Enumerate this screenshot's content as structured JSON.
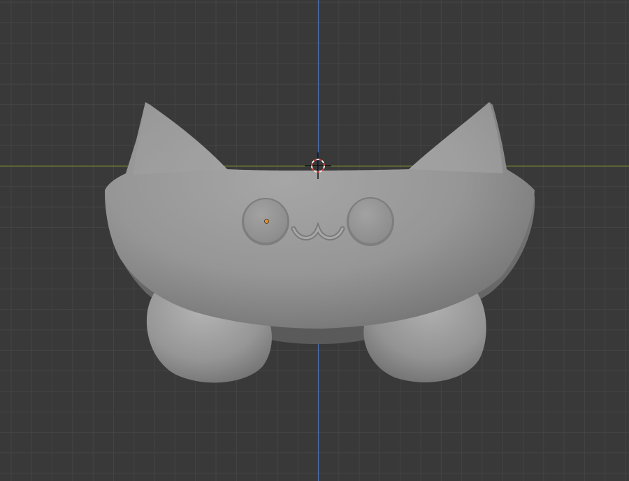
{
  "viewport": {
    "background_color": "#393939",
    "grid_color": "#444444",
    "x_axis_color": "#8a9a3c",
    "y_axis_color": "#4a6fb0"
  },
  "scene_object": {
    "name_icon": "cat-bowl-mesh",
    "shading": "solid",
    "base_color": "#9a9a9a",
    "origin_color": "#e8902a"
  },
  "cursor_3d": {
    "icon": "3d-cursor-crosshair-icon",
    "ring_colors": [
      "#d23a3a",
      "#f0f0f0"
    ]
  }
}
